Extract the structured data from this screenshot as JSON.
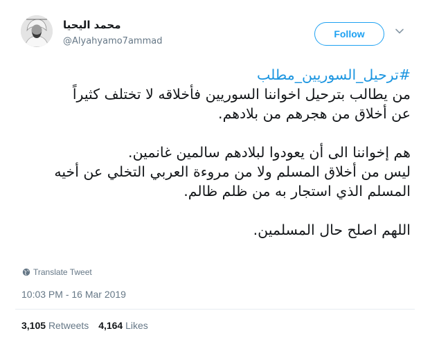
{
  "user": {
    "display_name": "محمد اليحيا",
    "handle": "@Alyahyamo7ammad"
  },
  "follow_button": {
    "label": "Follow"
  },
  "tweet": {
    "hashtag": "#ترحيل_السوريين_مطلب",
    "lines": [
      "من يطالب بترحيل اخواننا السوريين فأخلاقه لا تختلف كثيراً",
      "عن أخلاق من هجرهم من بلادهم.",
      "",
      "هم إخواننا الى أن يعودوا لبلادهم سالمين غانمين.",
      "ليس من أخلاق المسلم ولا من مروءة العربي التخلي عن أخيه",
      "المسلم الذي استجار به من ظلم ظالم.",
      "",
      "اللهم اصلح حال المسلمين."
    ]
  },
  "translate": {
    "label": "Translate Tweet",
    "icon": "globe-icon"
  },
  "timestamp": "10:03 PM - 16 Mar 2019",
  "stats": {
    "retweets_count": "3,105",
    "retweets_label": "Retweets",
    "likes_count": "4,164",
    "likes_label": "Likes"
  },
  "colors": {
    "accent": "#1da1f2",
    "hashtag": "#1b95e0",
    "muted": "#657786",
    "text": "#14171a"
  }
}
